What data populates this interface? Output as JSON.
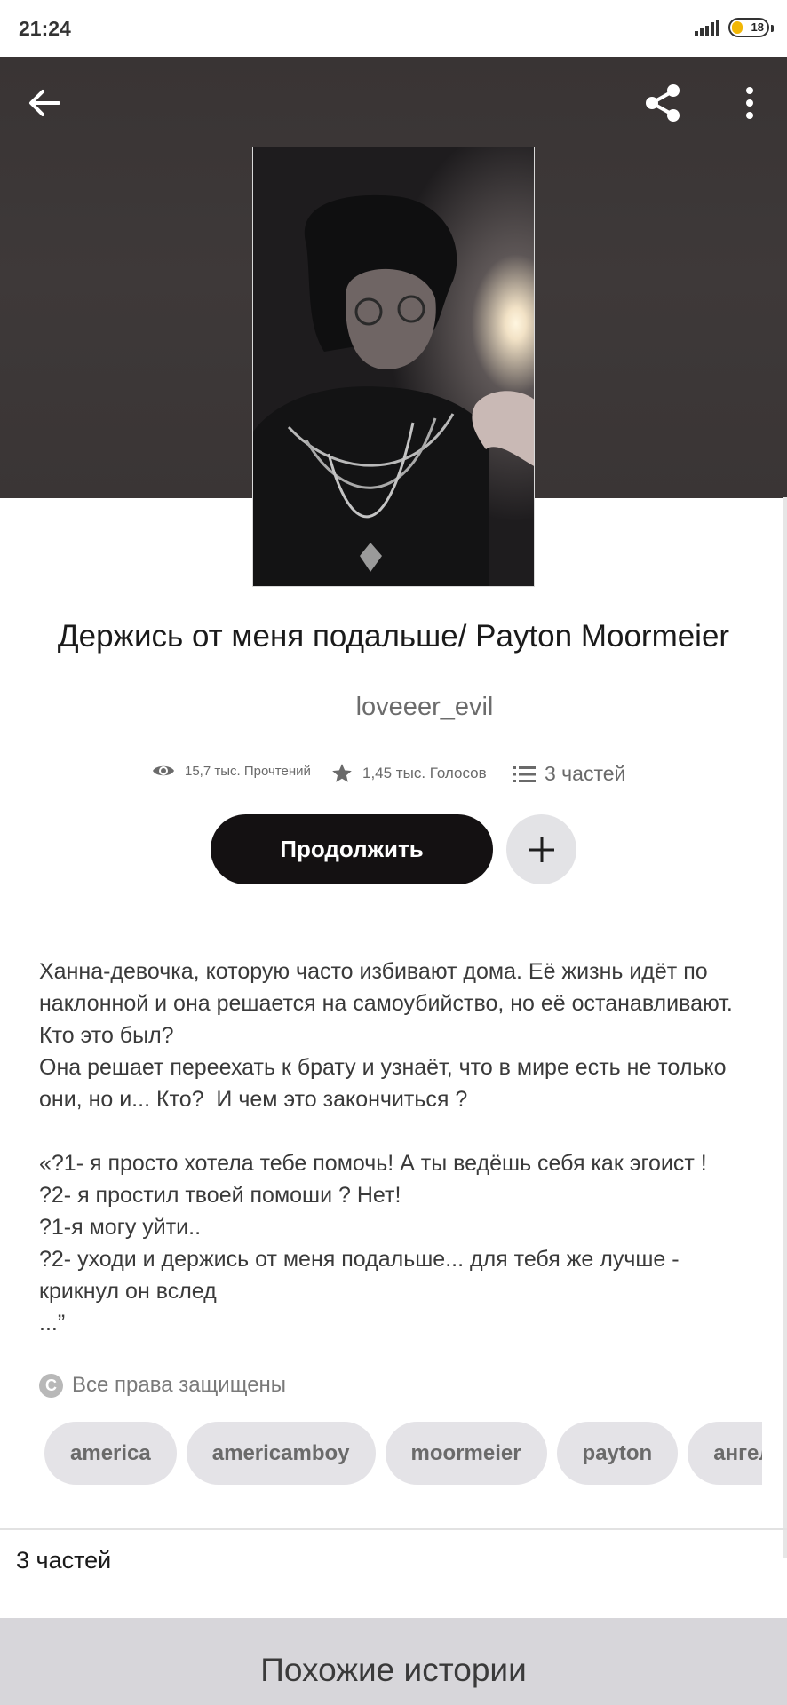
{
  "status_bar": {
    "time": "21:24",
    "battery": "18"
  },
  "story": {
    "title": "Держись от меня подальше/ Payton Moormeier",
    "author": "loveeer_evil",
    "stats": {
      "reads": "15,7 тыс. Прочтений",
      "votes": "1,45 тыс. Голосов",
      "parts": "3 частей"
    },
    "continue_label": "Продолжить",
    "description": [
      "Ханна-девочка, которую часто избивают дома. Её жизнь идёт по наклонной и она решается на самоубийство, но её останавливают. Кто это был?\nОна решает переехать к брату и узнаёт, что в мире есть не только они, но и... Кто?  И чем это закончиться ?",
      "«?1- я просто хотела тебе помочь! А ты ведёшь себя как эгоист !\n?2- я простил твоей помоши ? Нет!\n?1-я могу уйти..\n?2- уходи и держись от меня подальше... для тебя же лучше - крикнул он вслед\n...”"
    ],
    "rights": "Все права защищены",
    "rights_icon": "C",
    "tags": [
      "america",
      "americamboy",
      "moormeier",
      "payton",
      "ангел"
    ],
    "parts_label": "3 частей",
    "similar_title": "Похожие истории"
  },
  "colors": {
    "hero_bg": "#3c3737",
    "button_dark": "#141112",
    "tag_bg": "#e4e3e7",
    "similar_bg": "#d7d6da"
  },
  "icons": {
    "back": "arrow-left-icon",
    "share": "share-icon",
    "more": "more-vertical-icon",
    "reads": "eye-icon",
    "votes": "star-icon",
    "parts": "list-icon",
    "add": "plus-icon"
  }
}
